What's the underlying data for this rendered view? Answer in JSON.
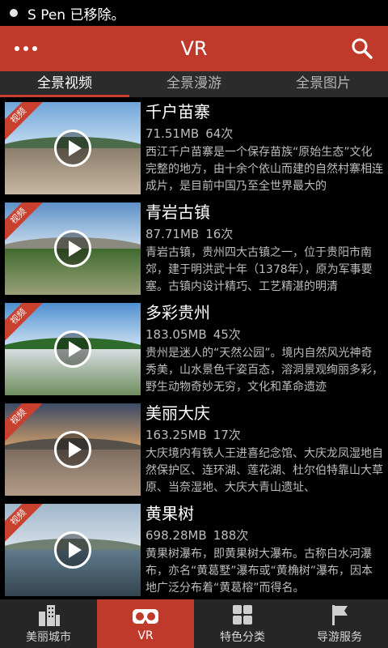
{
  "status_bar": {
    "message": "S Pen 已移除。"
  },
  "app_bar": {
    "title": "VR"
  },
  "tabs": [
    {
      "label": "全景视频",
      "active": true
    },
    {
      "label": "全景漫游",
      "active": false
    },
    {
      "label": "全景图片",
      "active": false
    }
  ],
  "items": [
    {
      "badge": "视频",
      "title": "千户苗寨",
      "size": "71.51MB",
      "views": "64次",
      "desc": "西江千户苗寨是一个保存苗族“原始生态”文化完整的地方，由十余个依山而建的自然村寨相连成片，是目前中国乃至全世界最大的"
    },
    {
      "badge": "视频",
      "title": "青岩古镇",
      "size": "87.71MB",
      "views": "16次",
      "desc": "青岩古镇，贵州四大古镇之一，位于贵阳市南郊，建于明洪武十年（1378年），原为军事要塞。古镇内设计精巧、工艺精湛的明清"
    },
    {
      "badge": "视频",
      "title": "多彩贵州",
      "size": "183.05MB",
      "views": "45次",
      "desc": "贵州是迷人的“天然公园”。境内自然风光神奇秀美，山水景色千姿百态，溶洞景观绚丽多彩，野生动物奇妙无穷，文化和革命遗迹"
    },
    {
      "badge": "视频",
      "title": "美丽大庆",
      "size": "163.25MB",
      "views": "17次",
      "desc": "大庆境内有铁人王进喜纪念馆、大庆龙凤湿地自然保护区、连环湖、莲花湖、杜尔伯特靠山大草原、当奈湿地、大庆大青山遗址、"
    },
    {
      "badge": "视频",
      "title": "黄果树",
      "size": "698.28MB",
      "views": "188次",
      "desc": "黄果树瀑布，即黄果树大瀑布。古称白水河瀑布，亦名“黄葛墅”瀑布或“黄桷树”瀑布，因本地广泛分布着“黄葛榕”而得名。"
    }
  ],
  "bottom_nav": [
    {
      "label": "美丽城市",
      "icon": "city-icon",
      "active": false
    },
    {
      "label": "VR",
      "icon": "vr-headset-icon",
      "active": true
    },
    {
      "label": "特色分类",
      "icon": "grid-icon",
      "active": false
    },
    {
      "label": "导游服务",
      "icon": "flag-icon",
      "active": false
    }
  ],
  "colors": {
    "accent": "#bf3a2a",
    "tab_bar": "#2b2b2b",
    "nav_bar": "#262626"
  }
}
